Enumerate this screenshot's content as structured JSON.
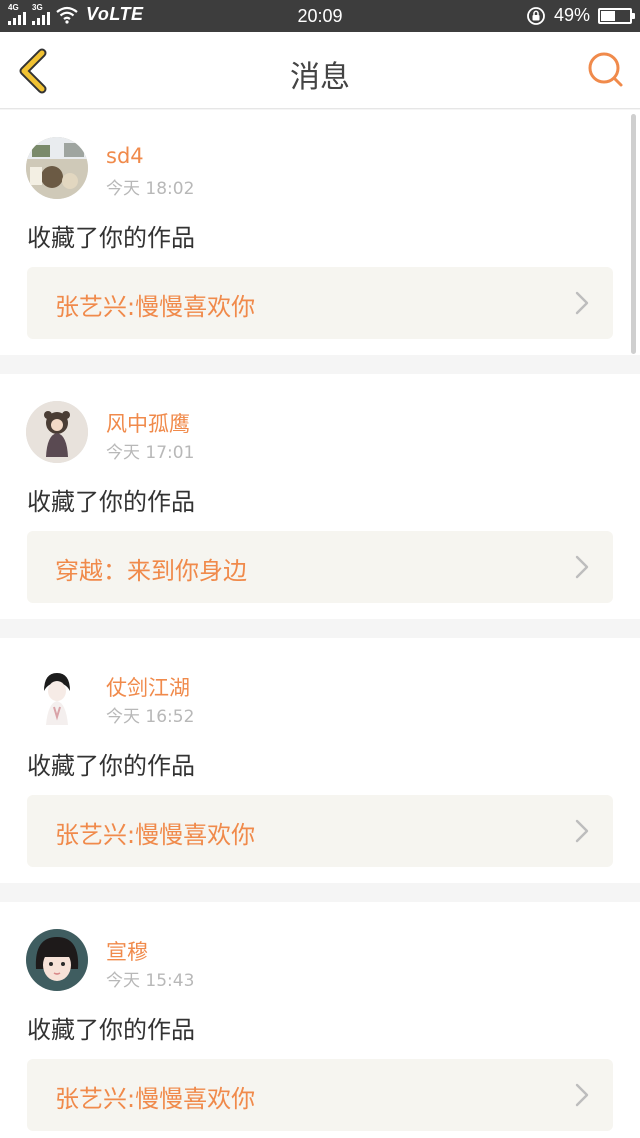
{
  "status_bar": {
    "sim1": "4G",
    "sim2": "3G",
    "volte": "VoLTE",
    "time": "20:09",
    "battery": "49%",
    "battery_level": 0.49
  },
  "header": {
    "title": "消息",
    "back_icon": "chevron-left-icon",
    "search_icon": "search-icon"
  },
  "colors": {
    "accent": "#f08a4b",
    "back_icon": "#f1c232"
  },
  "messages": [
    {
      "user": "sd4",
      "time": "今天 18:02",
      "action": "收藏了你的作品",
      "work": "张艺兴:慢慢喜欢你"
    },
    {
      "user": "风中孤鹰",
      "time": "今天 17:01",
      "action": "收藏了你的作品",
      "work": "穿越：来到你身边"
    },
    {
      "user": "仗剑江湖",
      "time": "今天 16:52",
      "action": "收藏了你的作品",
      "work": "张艺兴:慢慢喜欢你"
    },
    {
      "user": "宣穆",
      "time": "今天 15:43",
      "action": "收藏了你的作品",
      "work": "张艺兴:慢慢喜欢你"
    }
  ]
}
